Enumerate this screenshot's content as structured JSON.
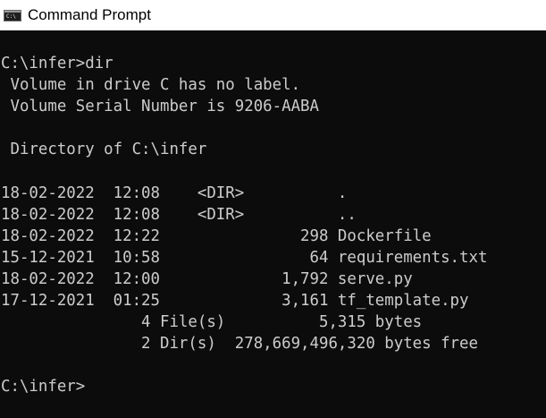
{
  "window": {
    "title": "Command Prompt",
    "icon": "cmd-console-icon",
    "icon_glyph": "C:\\",
    "colors": {
      "console_background": "#0c0c0c",
      "console_text": "#cccccc",
      "titlebar_background": "#ffffff",
      "titlebar_text": "#000000"
    }
  },
  "console": {
    "lines": [
      "C:\\infer>dir",
      " Volume in drive C has no label.",
      " Volume Serial Number is 9206-AABA",
      "",
      " Directory of C:\\infer",
      "",
      "18-02-2022  12:08    <DIR>          .",
      "18-02-2022  12:08    <DIR>          ..",
      "18-02-2022  12:22               298 Dockerfile",
      "15-12-2021  10:58                64 requirements.txt",
      "18-02-2022  12:00             1,792 serve.py",
      "17-12-2021  01:25             3,161 tf_template.py",
      "               4 File(s)          5,315 bytes",
      "               2 Dir(s)  278,669,496,320 bytes free",
      "",
      "C:\\infer>"
    ]
  }
}
